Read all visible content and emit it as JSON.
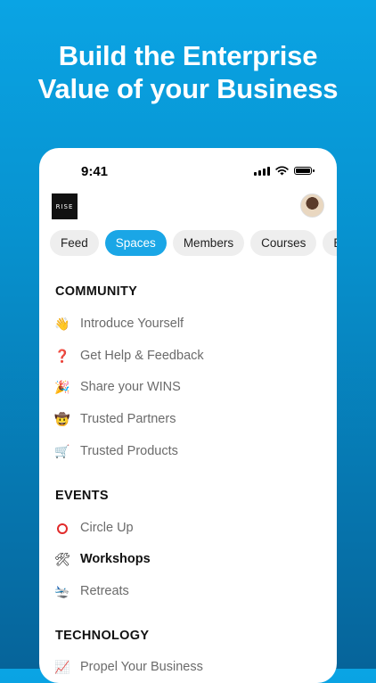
{
  "headline": {
    "line1": "Build the Enterprise",
    "line2": "Value of your Business"
  },
  "status_bar": {
    "time": "9:41"
  },
  "app": {
    "logo_text": "RISE"
  },
  "tabs": [
    {
      "label": "Feed"
    },
    {
      "label": "Spaces"
    },
    {
      "label": "Members"
    },
    {
      "label": "Courses"
    },
    {
      "label": "Events"
    }
  ],
  "sections": {
    "community": {
      "title": "COMMUNITY",
      "items": [
        {
          "icon": "waving-hand-icon",
          "glyph": "👋",
          "label": "Introduce Yourself"
        },
        {
          "icon": "question-mark-icon",
          "glyph": "❓",
          "label": "Get Help & Feedback"
        },
        {
          "icon": "party-popper-icon",
          "glyph": "🎉",
          "label": "Share your WINS"
        },
        {
          "icon": "cowboy-face-icon",
          "glyph": "🤠",
          "label": "Trusted Partners"
        },
        {
          "icon": "shopping-cart-icon",
          "glyph": "🛒",
          "label": "Trusted Products"
        }
      ]
    },
    "events": {
      "title": "EVENTS",
      "items": [
        {
          "icon": "red-circle-icon",
          "glyph": "",
          "label": "Circle Up"
        },
        {
          "icon": "tools-icon",
          "glyph": "🛠",
          "label": "Workshops"
        },
        {
          "icon": "airplane-icon",
          "glyph": "🛬",
          "label": "Retreats"
        }
      ]
    },
    "technology": {
      "title": "TECHNOLOGY",
      "items": [
        {
          "icon": "chart-icon",
          "glyph": "📈",
          "label": "Propel Your Business"
        }
      ]
    }
  },
  "colors": {
    "accent": "#1aa6e6",
    "background_top": "#0aa4e4",
    "background_bottom": "#06649a"
  }
}
